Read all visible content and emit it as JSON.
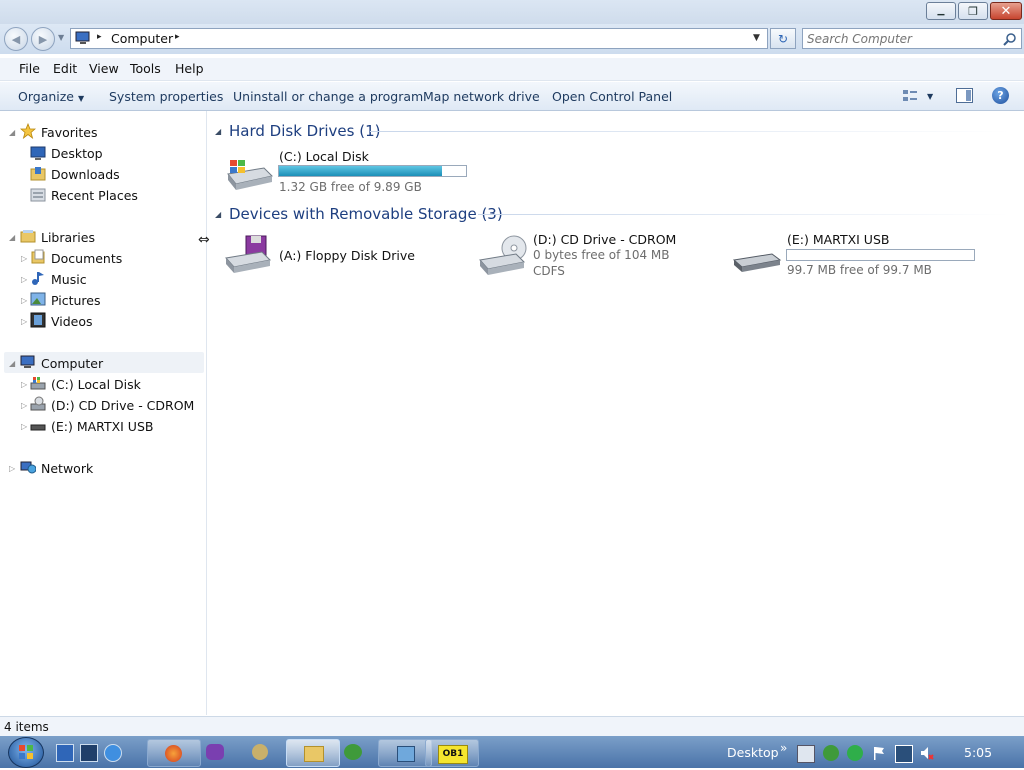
{
  "window": {
    "minimize": "▁",
    "maximize": "❐",
    "close": "✕"
  },
  "address": {
    "back_icon": "back-arrow-icon",
    "forward_icon": "forward-arrow-icon",
    "location_icon": "computer-icon",
    "breadcrumb_sep": "▸",
    "location": "Computer",
    "trailing_sep": "▸",
    "dropdown": "▼",
    "refresh": "↻",
    "search_placeholder": "Search Computer",
    "search_icon": "magnifier-icon"
  },
  "menu": {
    "file": "File",
    "edit": "Edit",
    "view": "View",
    "tools": "Tools",
    "help": "Help"
  },
  "commands": {
    "organize": "Organize",
    "organize_arrow": "▼",
    "system_properties": "System properties",
    "uninstall": "Uninstall or change a program",
    "map_network": "Map network drive",
    "control_panel": "Open Control Panel",
    "views_arrow": "▼",
    "help": "?"
  },
  "nav": {
    "favorites": "Favorites",
    "desktop": "Desktop",
    "downloads": "Downloads",
    "recent": "Recent Places",
    "libraries": "Libraries",
    "documents": "Documents",
    "music": "Music",
    "pictures": "Pictures",
    "videos": "Videos",
    "computer": "Computer",
    "local_disk": "(C:) Local Disk",
    "cd_drive": "(D:) CD Drive - CDROM",
    "usb": "(E:) MARTXI USB",
    "network": "Network",
    "expanded_marker": "◢",
    "collapsed_marker": "▷"
  },
  "content": {
    "hdd_group": {
      "title": "Hard Disk Drives (1)",
      "marker": "◢"
    },
    "removable_group": {
      "title": "Devices with Removable Storage (3)",
      "marker": "◢"
    },
    "drives": {
      "c": {
        "name": "(C:) Local Disk",
        "free": "1.32 GB free of 9.89 GB",
        "used_fraction": 0.87
      },
      "a": {
        "name": "(A:) Floppy Disk Drive"
      },
      "d": {
        "name": "(D:) CD Drive - CDROM",
        "free": "0 bytes free of 104 MB",
        "fs": "CDFS"
      },
      "e": {
        "name": "(E:) MARTXI USB",
        "free": "99.7 MB free of 99.7 MB",
        "used_fraction": 0.0
      }
    }
  },
  "status": {
    "items": "4 items"
  },
  "taskbar": {
    "pinned_label": "OB1",
    "desktop_label": "Desktop",
    "chevron": "»",
    "clock": "5:05"
  },
  "colors": {
    "group_header": "#1e3f80",
    "bar_fill": "#1b8fb8",
    "taskbar": "#4a73a8"
  }
}
